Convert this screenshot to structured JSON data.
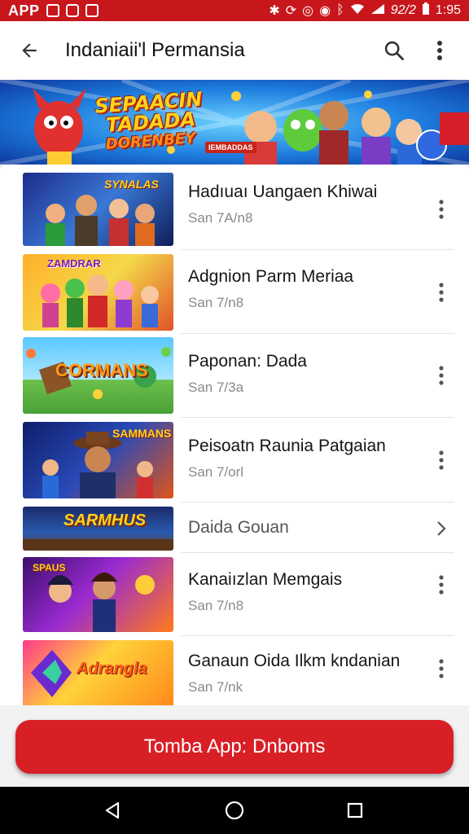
{
  "status_bar": {
    "app_label": "APP",
    "signal_text": "92/2",
    "time": "1:95",
    "color": "#c8161d"
  },
  "app_bar": {
    "title": "Indaniaii'l Permansia",
    "back_icon": "arrow-left-icon",
    "search_icon": "search-icon",
    "more_icon": "more-vert-icon"
  },
  "banner": {
    "headline_lines": [
      "SEPAACIN",
      "TADADA",
      "DORENBEY"
    ],
    "tag_text": "IEMBADDAS"
  },
  "list": {
    "items": [
      {
        "title": "Hadıuaı Uangaen Khiwai",
        "subtitle": "San 7A/n8",
        "thumb_text": "SYNALAS",
        "kind": "menu"
      },
      {
        "title": "Adgnion Parm Meriaa",
        "subtitle": "San 7/n8",
        "thumb_text": "ZAMDRAR",
        "kind": "menu"
      },
      {
        "title": "Paponan: Dada",
        "subtitle": "San 7/3a",
        "thumb_text": "CORMANS",
        "kind": "menu"
      },
      {
        "title": "Peisoatn Raunia Patgaian",
        "subtitle": "San 7/orl",
        "thumb_text": "SAMMANS",
        "kind": "menu"
      },
      {
        "title": "Daida Gouan",
        "subtitle": "",
        "thumb_text": "SARMHUS",
        "kind": "chevron"
      },
      {
        "title": "Kanaiızlan Memgais",
        "subtitle": "San 7/n8",
        "thumb_text": "SPAUS",
        "kind": "menu"
      },
      {
        "title": "Ganaun Oida Ilkm kndanian",
        "subtitle": "San 7/nk",
        "thumb_text": "Adrangla",
        "kind": "menu"
      }
    ]
  },
  "cta": {
    "label": "Tomba App: Dnboms",
    "color": "#d91f26"
  },
  "nav_bar": {
    "back_icon": "triangle-back-icon",
    "home_icon": "circle-home-icon",
    "recents_icon": "square-recents-icon"
  }
}
